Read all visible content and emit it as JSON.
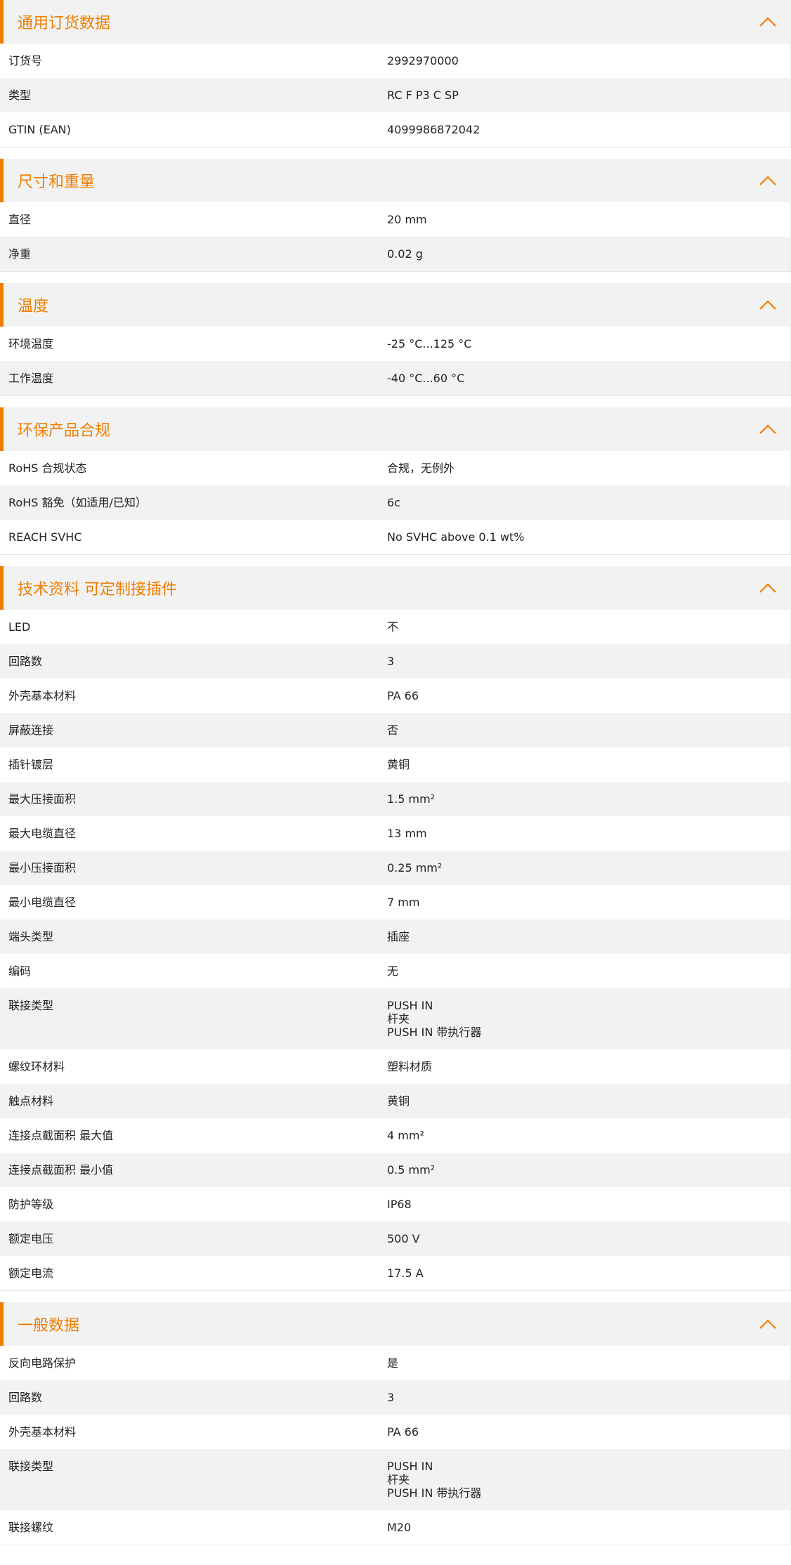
{
  "accent_color": "#f07d00",
  "sections": [
    {
      "title": "通用订货数据",
      "collapse_icon": "chevron-up-icon",
      "rows": [
        {
          "label": "订货号",
          "value": [
            "2992970000"
          ]
        },
        {
          "label": "类型",
          "value": [
            "RC F P3 C SP"
          ]
        },
        {
          "label": "GTIN (EAN)",
          "value": [
            "4099986872042"
          ]
        }
      ]
    },
    {
      "title": "尺寸和重量",
      "collapse_icon": "chevron-up-icon",
      "rows": [
        {
          "label": "直径",
          "value": [
            "20  mm"
          ]
        },
        {
          "label": "净重",
          "value": [
            "0.02  g"
          ]
        }
      ]
    },
    {
      "title": "温度",
      "collapse_icon": "chevron-up-icon",
      "rows": [
        {
          "label": "环境温度",
          "value": [
            "-25 °C...125 °C"
          ]
        },
        {
          "label": "工作温度",
          "value": [
            "-40 °C...60 °C"
          ]
        }
      ]
    },
    {
      "title": "环保产品合规",
      "collapse_icon": "chevron-up-icon",
      "rows": [
        {
          "label": "RoHS 合规状态",
          "value": [
            "合规，无例外"
          ]
        },
        {
          "label": "RoHS 豁免（如适用/已知）",
          "value": [
            "6c"
          ]
        },
        {
          "label": "REACH SVHC",
          "value": [
            "No SVHC above 0.1 wt%"
          ]
        }
      ]
    },
    {
      "title": "技术资料 可定制接插件",
      "collapse_icon": "chevron-up-icon",
      "rows": [
        {
          "label": "LED",
          "value": [
            "不"
          ]
        },
        {
          "label": "回路数",
          "value": [
            "3"
          ]
        },
        {
          "label": "外壳基本材料",
          "value": [
            "PA 66"
          ]
        },
        {
          "label": "屏蔽连接",
          "value": [
            "否"
          ]
        },
        {
          "label": "插针镀层",
          "value": [
            "黄铜"
          ]
        },
        {
          "label": "最大压接面积",
          "value": [
            "1.5  mm²"
          ]
        },
        {
          "label": "最大电缆直径",
          "value": [
            "13  mm"
          ]
        },
        {
          "label": "最小压接面积",
          "value": [
            "0.25  mm²"
          ]
        },
        {
          "label": "最小电缆直径",
          "value": [
            "7  mm"
          ]
        },
        {
          "label": "端头类型",
          "value": [
            "插座"
          ]
        },
        {
          "label": "编码",
          "value": [
            "无"
          ]
        },
        {
          "label": "联接类型",
          "value": [
            "PUSH IN",
            "杆夹",
            "PUSH IN 带执行器"
          ]
        },
        {
          "label": "螺纹环材料",
          "value": [
            "塑料材质"
          ]
        },
        {
          "label": "触点材料",
          "value": [
            "黄铜"
          ]
        },
        {
          "label": "连接点截面积 最大值",
          "value": [
            "4  mm²"
          ]
        },
        {
          "label": "连接点截面积 最小值",
          "value": [
            "0.5  mm²"
          ]
        },
        {
          "label": "防护等级",
          "value": [
            "IP68"
          ]
        },
        {
          "label": "额定电压",
          "value": [
            "500  V"
          ]
        },
        {
          "label": "额定电流",
          "value": [
            "17.5  A"
          ]
        }
      ]
    },
    {
      "title": "一般数据",
      "collapse_icon": "chevron-up-icon",
      "rows": [
        {
          "label": "反向电路保护",
          "value": [
            "是"
          ]
        },
        {
          "label": "回路数",
          "value": [
            "3"
          ]
        },
        {
          "label": "外壳基本材料",
          "value": [
            "PA 66"
          ]
        },
        {
          "label": "联接类型",
          "value": [
            "PUSH IN",
            "杆夹",
            "PUSH IN 带执行器"
          ]
        },
        {
          "label": "联接螺纹",
          "value": [
            "M20"
          ]
        }
      ]
    }
  ]
}
